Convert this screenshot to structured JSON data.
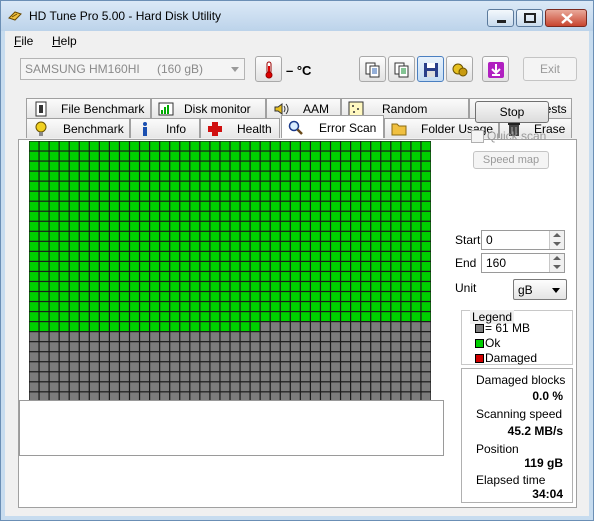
{
  "window": {
    "title": "HD Tune Pro 5.00 - Hard Disk Utility"
  },
  "menu": [
    {
      "label": "File"
    },
    {
      "label": "Help"
    }
  ],
  "toolbar": {
    "drive_name": "SAMSUNG HM160HI",
    "drive_size": "(160 gB)",
    "temperature": "– °C",
    "exit_label": "Exit",
    "icons": [
      "thermometer-icon",
      "copy-icon",
      "copy-all-icon",
      "save-icon",
      "screenshot-icon",
      "update-icon"
    ]
  },
  "tabs_row1": [
    {
      "label": "File Benchmark",
      "icon": "file-benchmark-icon"
    },
    {
      "label": "Disk monitor",
      "icon": "disk-monitor-icon"
    },
    {
      "label": "AAM",
      "icon": "speaker-icon"
    },
    {
      "label": "Random Access",
      "icon": "random-access-icon"
    },
    {
      "label": "Extra tests",
      "icon": "extra-tests-icon"
    }
  ],
  "tabs_row2": [
    {
      "label": "Benchmark",
      "icon": "lightbulb-icon"
    },
    {
      "label": "Info",
      "icon": "info-icon"
    },
    {
      "label": "Health",
      "icon": "health-cross-icon"
    },
    {
      "label": "Error Scan",
      "icon": "magnifier-icon",
      "active": true
    },
    {
      "label": "Folder Usage",
      "icon": "folder-icon"
    },
    {
      "label": "Erase",
      "icon": "trash-icon"
    }
  ],
  "scan": {
    "grid_columns": 40,
    "grid_rows": 30,
    "scanned_blocks": 743,
    "ok_color": "#00d000",
    "pending_color": "#7c7c7c",
    "damaged_color": "#d00000"
  },
  "controls": {
    "stop_label": "Stop",
    "quick_scan_label": "Quick scan",
    "speed_map_label": "Speed map",
    "start_label": "Start",
    "start_value": "0",
    "end_label": "End",
    "end_value": "160",
    "unit_label": "Unit",
    "unit_value": "gB"
  },
  "legend": {
    "title": "Legend",
    "block_size": "= 61 MB",
    "ok": "Ok",
    "damaged": "Damaged"
  },
  "stats": {
    "damaged_label": "Damaged blocks",
    "damaged_value": "0.0 %",
    "speed_label": "Scanning speed",
    "speed_value": "45.2 MB/s",
    "position_label": "Position",
    "position_value": "119 gB",
    "elapsed_label": "Elapsed time",
    "elapsed_value": "34:04"
  }
}
